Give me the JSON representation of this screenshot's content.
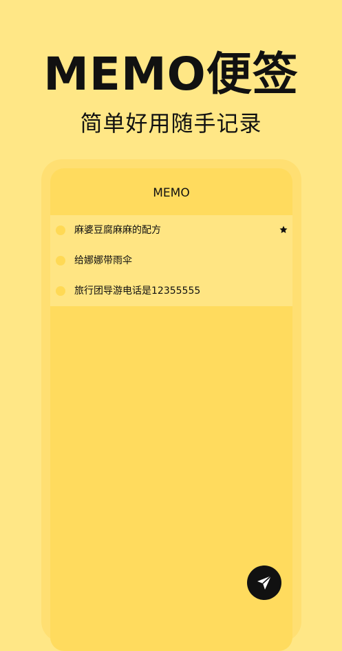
{
  "hero": {
    "title": "MEMO便签",
    "subtitle": "简单好用随手记录"
  },
  "app": {
    "title": "MEMO"
  },
  "memos": [
    {
      "text": "麻婆豆腐麻麻的配方",
      "pinned": true
    },
    {
      "text": "给娜娜带雨伞",
      "pinned": false
    },
    {
      "text": "旅行团导游电话是12355555",
      "pinned": false
    }
  ],
  "icons": {
    "pin": "pin-icon",
    "send": "paper-plane-icon"
  },
  "colors": {
    "background": "#FFE786",
    "frame": "#FFDF72",
    "screen": "#FFDB5E",
    "list": "#FFE583",
    "dot": "#FFD955",
    "text": "#111111",
    "fab": "#111111"
  }
}
